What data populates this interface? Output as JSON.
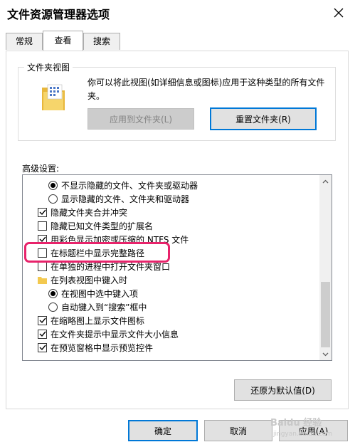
{
  "window": {
    "title": "文件资源管理器选项"
  },
  "tabs": [
    {
      "label": "常规",
      "active": false
    },
    {
      "label": "查看",
      "active": true
    },
    {
      "label": "搜索",
      "active": false
    }
  ],
  "folder_views": {
    "group_title": "文件夹视图",
    "description": "你可以将此视图(如详细信息或图标)应用于这种类型的所有文件夹。",
    "apply_button": "应用到文件夹(L)",
    "reset_button": "重置文件夹(R)"
  },
  "advanced": {
    "label": "高级设置:",
    "items": [
      {
        "type": "radio",
        "checked": true,
        "indent": 1,
        "label": "不显示隐藏的文件、文件夹或驱动器"
      },
      {
        "type": "radio",
        "checked": false,
        "indent": 1,
        "label": "显示隐藏的文件、文件夹和驱动器"
      },
      {
        "type": "checkbox",
        "checked": true,
        "indent": 0,
        "label": "隐藏文件夹合并冲突"
      },
      {
        "type": "checkbox",
        "checked": false,
        "indent": 0,
        "label": "隐藏已知文件类型的扩展名"
      },
      {
        "type": "checkbox",
        "checked": true,
        "indent": 0,
        "label": "用彩色显示加密或压缩的 NTFS 文件"
      },
      {
        "type": "checkbox",
        "checked": false,
        "indent": 0,
        "label": "在标题栏中显示完整路径"
      },
      {
        "type": "checkbox",
        "checked": false,
        "indent": 0,
        "label": "在单独的进程中打开文件夹窗口"
      },
      {
        "type": "folder",
        "checked": false,
        "indent": 0,
        "label": "在列表视图中键入时"
      },
      {
        "type": "radio",
        "checked": true,
        "indent": 1,
        "label": "在视图中选中键入项"
      },
      {
        "type": "radio",
        "checked": false,
        "indent": 1,
        "label": "自动键入到“搜索”框中"
      },
      {
        "type": "checkbox",
        "checked": true,
        "indent": 0,
        "label": "在缩略图上显示文件图标"
      },
      {
        "type": "checkbox",
        "checked": true,
        "indent": 0,
        "label": "在文件夹提示中显示文件大小信息"
      },
      {
        "type": "checkbox",
        "checked": true,
        "indent": 0,
        "label": "在预览窗格中显示预览控件"
      }
    ],
    "restore_button": "还原为默认值(D)"
  },
  "footer": {
    "ok": "确定",
    "cancel": "取消",
    "apply": "应用(A)"
  },
  "watermark": {
    "text": "Baidu 经验",
    "sub": "jingyan.baidu.com"
  },
  "colors": {
    "highlight": "#e8236b",
    "accent": "#0078d7",
    "folder": "#f3c94f"
  }
}
